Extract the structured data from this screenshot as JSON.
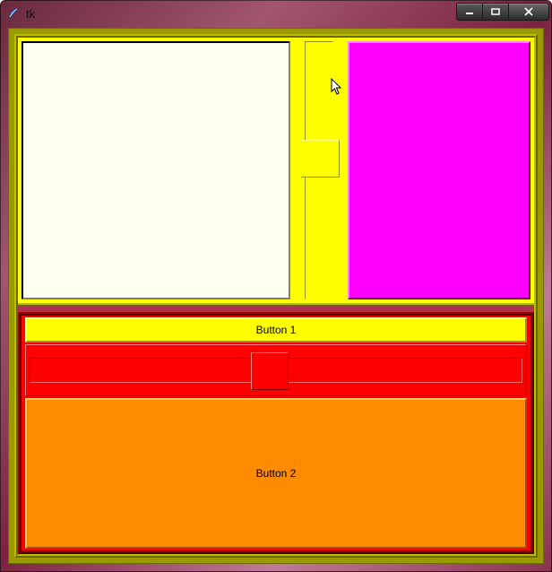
{
  "window": {
    "title": "tk",
    "caption": {
      "min_tooltip": "Minimize",
      "max_tooltip": "Maximize",
      "close_tooltip": "Close"
    }
  },
  "top_panel": {
    "text_area_value": "",
    "v_scale": {
      "min": 0,
      "max": 100,
      "value": 40
    },
    "magenta_panel_value": ""
  },
  "bottom_panel": {
    "button1_label": "Button 1",
    "h_scale": {
      "min": 0,
      "max": 100,
      "value": 45
    },
    "button2_label": "Button 2"
  },
  "colors": {
    "outer_frame": "#ffff00",
    "text_bg": "#fffff0",
    "magenta": "#ff00ff",
    "bottom_bg": "#ff0000",
    "button1_bg": "#ffff00",
    "button2_bg": "#ff8c00",
    "olive": "#9a9a00"
  }
}
